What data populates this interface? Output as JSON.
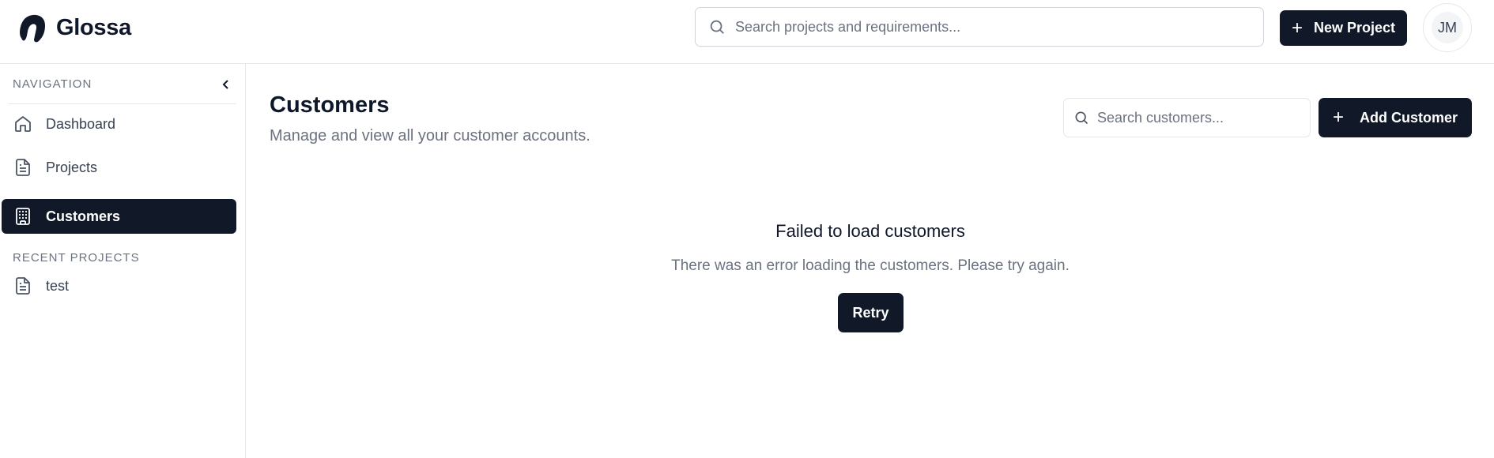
{
  "app": {
    "name": "Glossa",
    "accent": "#111827"
  },
  "header": {
    "search_placeholder": "Search projects and requirements...",
    "new_project_label": "New Project",
    "new_project_icon": "plus-icon",
    "avatar_initials": "JM"
  },
  "sidebar": {
    "nav_heading": "NAVIGATION",
    "collapse_icon": "chevron-left-icon",
    "items": [
      {
        "label": "Dashboard",
        "icon": "home-icon",
        "active": false
      },
      {
        "label": "Projects",
        "icon": "file-text-icon",
        "active": false
      },
      {
        "label": "Customers",
        "icon": "building-icon",
        "active": true
      }
    ],
    "recent_heading": "RECENT PROJECTS",
    "recent_projects": [
      {
        "label": "test",
        "icon": "file-text-icon"
      }
    ]
  },
  "main": {
    "title": "Customers",
    "subtitle": "Manage and view all your customer accounts.",
    "search_placeholder": "Search customers...",
    "add_customer_label": "Add Customer",
    "error_title": "Failed to load customers",
    "error_message": "There was an error loading the customers. Please try again.",
    "retry_label": "Retry"
  }
}
